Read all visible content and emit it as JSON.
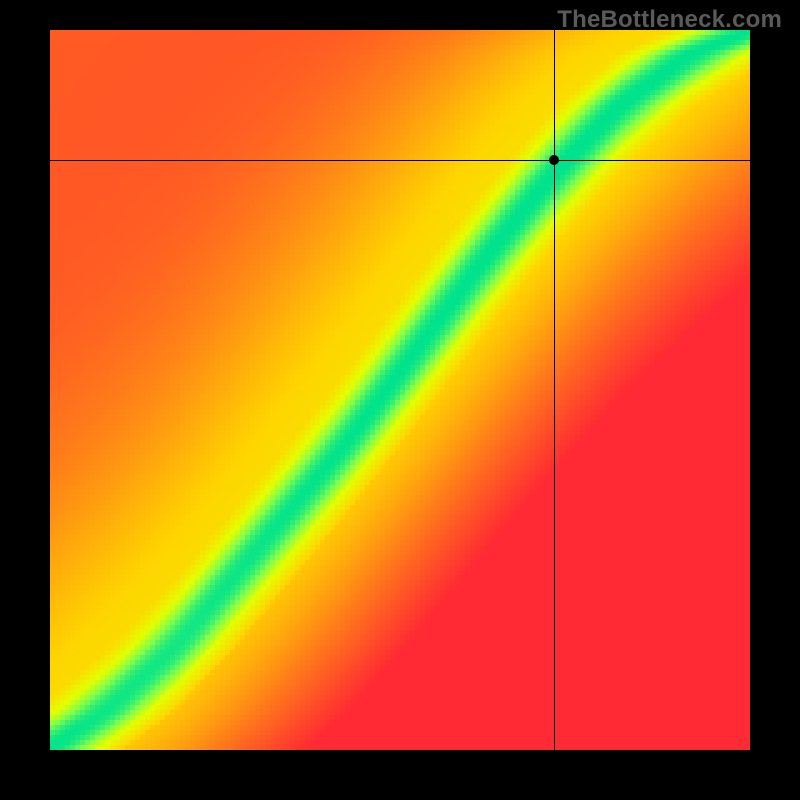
{
  "attribution": "TheBottleneck.com",
  "chart_data": {
    "type": "heatmap",
    "title": "",
    "xlabel": "",
    "ylabel": "",
    "xlim": [
      0,
      1
    ],
    "ylim": [
      0,
      1
    ],
    "legend_position": "none",
    "grid": false,
    "marker": {
      "x": 0.72,
      "y": 0.82
    },
    "crosshair": {
      "x": 0.72,
      "y": 0.82
    },
    "color_stops": [
      {
        "t": 0.0,
        "hex": "#ff2a33"
      },
      {
        "t": 0.25,
        "hex": "#ff7a1a"
      },
      {
        "t": 0.5,
        "hex": "#ffd400"
      },
      {
        "t": 0.75,
        "hex": "#e4ff00"
      },
      {
        "t": 0.88,
        "hex": "#85ff4a"
      },
      {
        "t": 1.0,
        "hex": "#00e38c"
      }
    ],
    "ridge": {
      "description": "Green optimal band running roughly diagonally with slight S-curve",
      "points": [
        {
          "x": 0.0,
          "y": 0.0
        },
        {
          "x": 0.08,
          "y": 0.05
        },
        {
          "x": 0.18,
          "y": 0.14
        },
        {
          "x": 0.3,
          "y": 0.28
        },
        {
          "x": 0.42,
          "y": 0.42
        },
        {
          "x": 0.52,
          "y": 0.55
        },
        {
          "x": 0.62,
          "y": 0.68
        },
        {
          "x": 0.72,
          "y": 0.8
        },
        {
          "x": 0.82,
          "y": 0.9
        },
        {
          "x": 0.92,
          "y": 0.97
        },
        {
          "x": 1.0,
          "y": 1.0
        }
      ],
      "band_width": 0.08
    },
    "resolution": {
      "w": 140,
      "h": 144
    }
  }
}
